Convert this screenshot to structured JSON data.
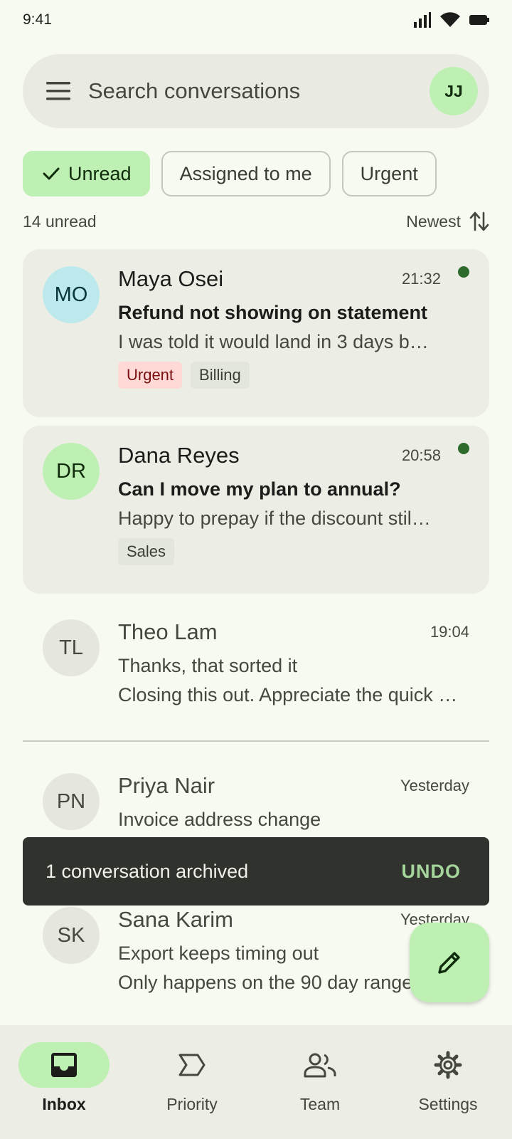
{
  "status_bar": {
    "time": "9:41"
  },
  "search": {
    "placeholder": "Search conversations",
    "avatar_initials": "JJ"
  },
  "filters": [
    {
      "label": "Unread",
      "selected": true
    },
    {
      "label": "Assigned to me",
      "selected": false
    },
    {
      "label": "Urgent",
      "selected": false
    }
  ],
  "list_meta": {
    "count": "14 unread",
    "sort_label": "Newest"
  },
  "conversations": [
    {
      "initials": "MO",
      "name": "Maya Osei",
      "time": "21:32",
      "subject": "Refund not showing on statement",
      "preview": "I was told it would land in 3 days b…",
      "tags": [
        "Urgent",
        "Billing"
      ],
      "unread": true
    },
    {
      "initials": "DR",
      "name": "Dana Reyes",
      "time": "20:58",
      "subject": "Can I move my plan to annual?",
      "preview": "Happy to prepay if the discount stil…",
      "tags": [
        "Sales"
      ],
      "unread": true
    },
    {
      "initials": "TL",
      "name": "Theo Lam",
      "time": "19:04",
      "subject": "Thanks, that sorted it",
      "preview": "Closing this out. Appreciate the quick …",
      "unread": false
    },
    {
      "initials": "PN",
      "name": "Priya Nair",
      "time": "Yesterday",
      "subject": "Invoice address change",
      "unread": false
    },
    {
      "initials": "SK",
      "name": "Sana Karim",
      "time": "Yesterday",
      "subject": "Export keeps timing out",
      "preview": "Only happens on the 90 day range,",
      "unread": false
    }
  ],
  "snackbar": {
    "message": "1 conversation archived",
    "action": "UNDO"
  },
  "bottom_nav": [
    {
      "label": "Inbox",
      "active": true
    },
    {
      "label": "Priority",
      "active": false
    },
    {
      "label": "Team",
      "active": false
    },
    {
      "label": "Settings",
      "active": false
    }
  ],
  "colors": {
    "accent": "#bdf0b2",
    "unread_dot": "#2e6a2c",
    "urgent_tag": "#ffd9d6",
    "snackbar_action": "#a5d59b"
  }
}
